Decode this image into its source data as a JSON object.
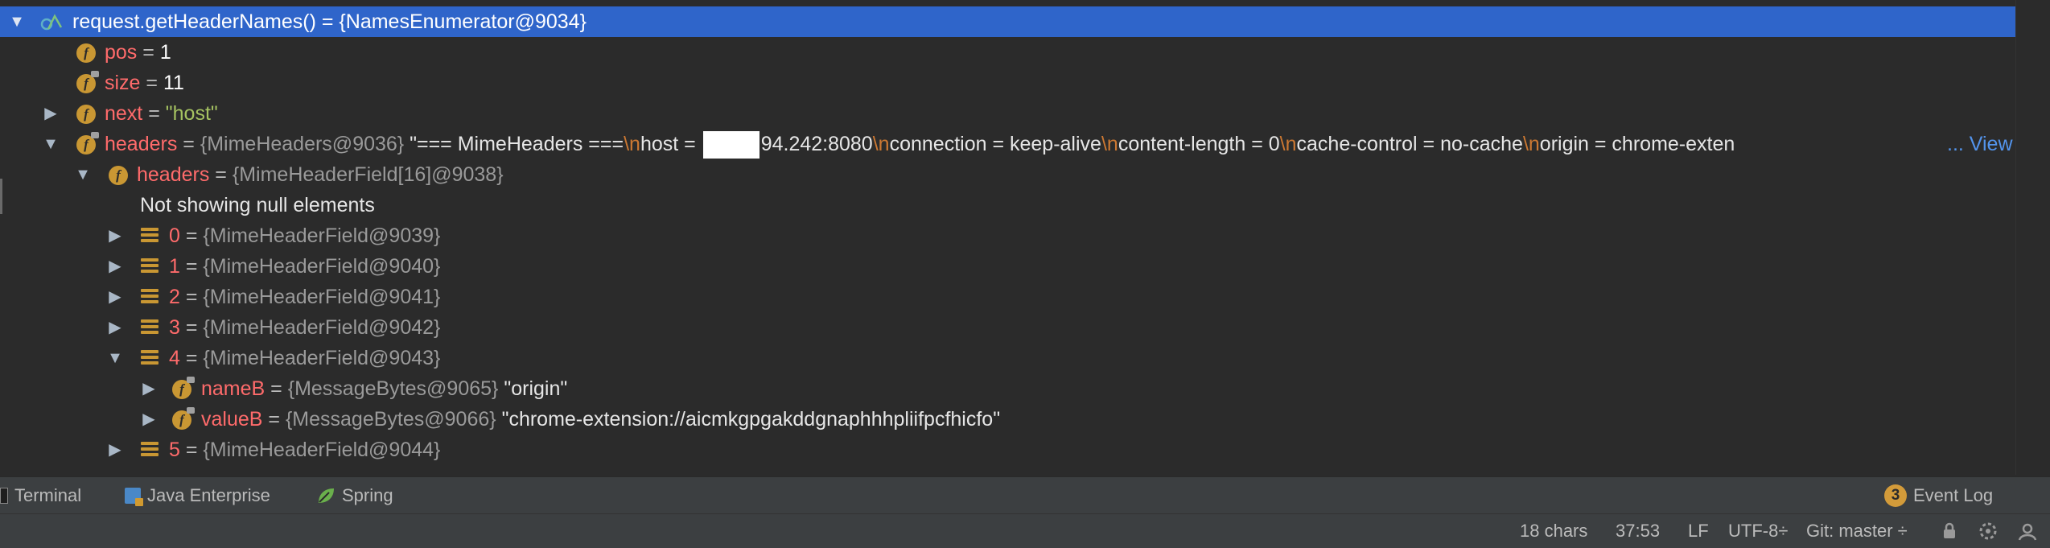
{
  "rows": [
    {
      "name": "request.getHeaderNames()",
      "eq": " = ",
      "ref": "{NamesEnumerator@9034}"
    },
    {
      "name": "pos",
      "eq": " = ",
      "value": "1"
    },
    {
      "name": "size",
      "eq": " = ",
      "value": "11"
    },
    {
      "name": "next",
      "eq": " = ",
      "value": "\"host\""
    },
    {
      "name": "headers",
      "eq": " = ",
      "ref": "{MimeHeaders@9036}",
      "value_parts": {
        "p1": " \"=== MimeHeaders ===",
        "e1": "\\n",
        "p2": "host = ",
        "p3": "94.242:8080",
        "e2": "\\n",
        "p4": "connection = keep-alive",
        "e3": "\\n",
        "p5": "content-length = 0",
        "e4": "\\n",
        "p6": "cache-control = no-cache",
        "e5": "\\n",
        "p7": "origin = chrome-exten",
        "more": "... View"
      }
    },
    {
      "name": "headers",
      "eq": " = ",
      "ref": "{MimeHeaderField[16]@9038}"
    },
    {
      "text": "Not showing null elements"
    },
    {
      "name": "0",
      "eq": " = ",
      "ref": "{MimeHeaderField@9039}"
    },
    {
      "name": "1",
      "eq": " = ",
      "ref": "{MimeHeaderField@9040}"
    },
    {
      "name": "2",
      "eq": " = ",
      "ref": "{MimeHeaderField@9041}"
    },
    {
      "name": "3",
      "eq": " = ",
      "ref": "{MimeHeaderField@9042}"
    },
    {
      "name": "4",
      "eq": " = ",
      "ref": "{MimeHeaderField@9043}"
    },
    {
      "name": "nameB",
      "eq": " = ",
      "ref": "{MessageBytes@9065}",
      "value": " \"origin\""
    },
    {
      "name": "valueB",
      "eq": " = ",
      "ref": "{MessageBytes@9066}",
      "value": " \"chrome-extension://aicmkgpgakddgnaphhhpliifpcfhicfo\""
    },
    {
      "name": "5",
      "eq": " = ",
      "ref": "{MimeHeaderField@9044}"
    }
  ],
  "toolwindows": {
    "terminal": "Terminal",
    "java_enterprise": "Java Enterprise",
    "spring": "Spring",
    "event_log": "Event Log",
    "event_count": "3"
  },
  "status": {
    "chars": "18 chars",
    "position": "37:53",
    "line_sep": "LF",
    "encoding": "UTF-8÷",
    "git": "Git: master ÷"
  },
  "icons": {
    "field": "field-icon",
    "array": "array-element-icon",
    "watch": "watch-expression-icon",
    "expanded": "expanded-arrow-icon",
    "collapsed": "collapsed-arrow-icon"
  },
  "colors": {
    "selection": "#2f65ca",
    "field_name": "#ff6b6b",
    "string": "#a5c261",
    "escape": "#cc7832",
    "link": "#5394ec",
    "field_icon": "#c99733"
  }
}
